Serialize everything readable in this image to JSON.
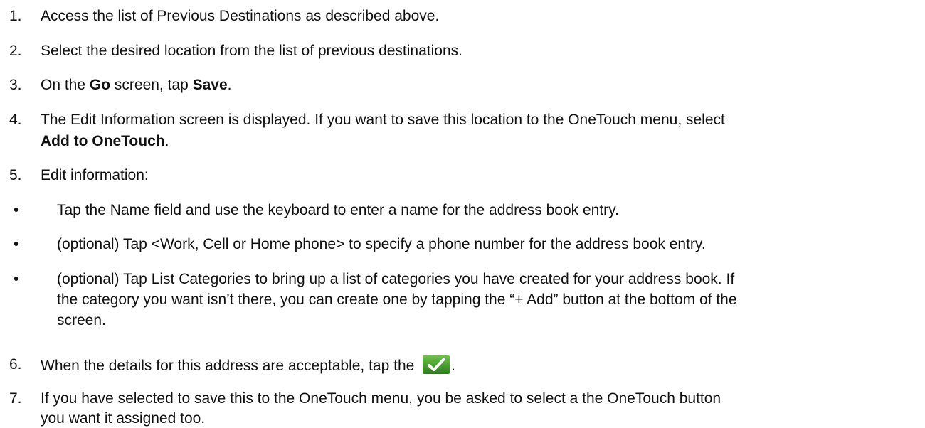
{
  "steps": [
    {
      "num": "1.",
      "text": "Access the list of Previous Destinations as described above."
    },
    {
      "num": "2.",
      "text": "Select the desired location from the list of previous destinations."
    },
    {
      "num": "3.",
      "pre": "On the ",
      "bold1": "Go",
      "mid": " screen, tap ",
      "bold2": "Save",
      "post": "."
    },
    {
      "num": "4.",
      "line1": "The Edit Information screen is displayed.  If you want to save this location to the OneTouch menu, select",
      "bold": "Add to OneTouch",
      "post": "."
    },
    {
      "num": "5.",
      "text": "Edit information:"
    },
    {
      "num": "6.",
      "pre": "When the details for this address are acceptable, tap the ",
      "post": "."
    },
    {
      "num": "7.",
      "line1": "If you have selected to save this to the OneTouch menu, you be asked to select a the OneTouch button",
      "line2": "you want it assigned too."
    }
  ],
  "bullets": [
    {
      "symbol": "•",
      "lines": [
        "Tap the Name field and use the keyboard to enter a name for the address book entry."
      ]
    },
    {
      "symbol": "•",
      "lines": [
        "(optional) Tap <Work, Cell or Home phone> to specify a phone number for the address book entry."
      ]
    },
    {
      "symbol": "•",
      "lines": [
        "(optional) Tap List Categories to bring up a list of categories you have created for your address book.  If",
        "the category you want isn’t there, you can create one by tapping the “+ Add” button at the bottom of the",
        "screen."
      ]
    }
  ],
  "icons": {
    "confirm": "checkmark-icon",
    "confirm_color": "#3f9a2a"
  }
}
